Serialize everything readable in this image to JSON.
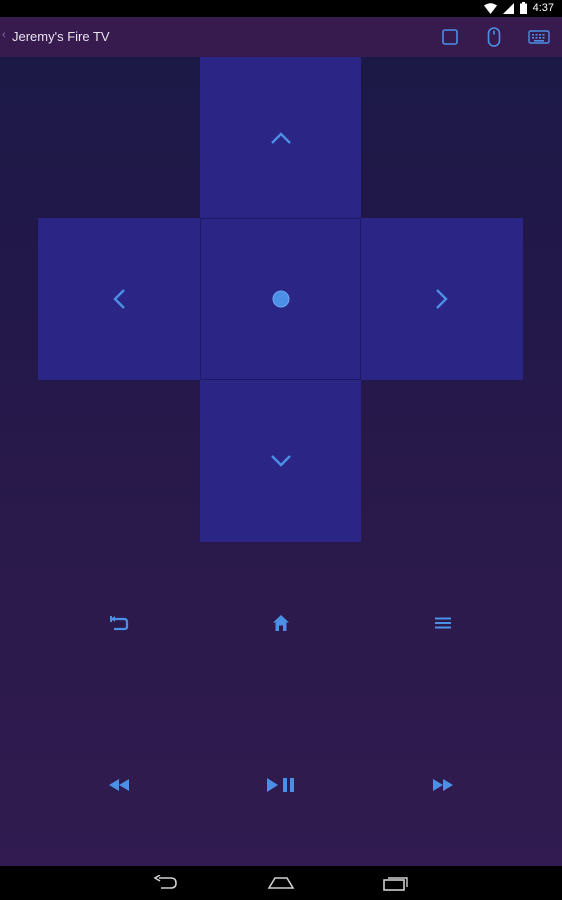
{
  "status_bar": {
    "time": "4:37",
    "icons": [
      "wifi-icon",
      "cell-signal-icon",
      "battery-icon"
    ]
  },
  "app_bar": {
    "title": "Jeremy's Fire TV",
    "actions": [
      "square-icon",
      "mouse-icon",
      "keyboard-icon"
    ]
  },
  "dpad": {
    "buttons": [
      "up",
      "left",
      "select",
      "right",
      "down"
    ]
  },
  "controls": {
    "row1": [
      "back",
      "home",
      "menu"
    ],
    "row2": [
      "rewind",
      "play-pause",
      "fast-forward"
    ]
  },
  "nav_bar": {
    "buttons": [
      "back",
      "home",
      "recents"
    ]
  },
  "colors": {
    "accent": "#4b8fe6",
    "dpad": "#2b2585",
    "app_bar": "#371a4e"
  }
}
